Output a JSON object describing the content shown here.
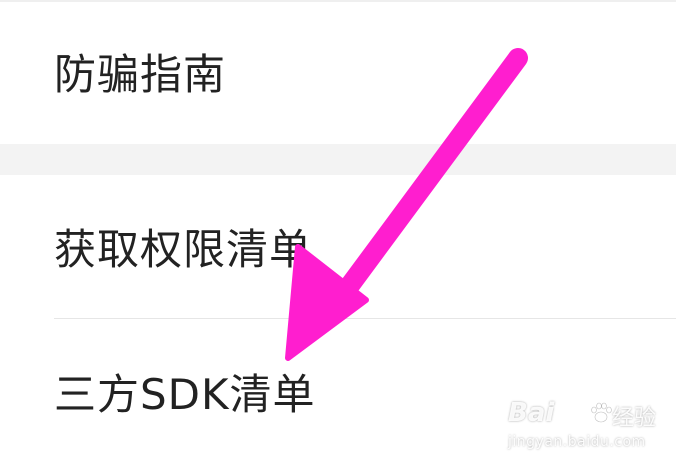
{
  "menu": {
    "items": [
      {
        "label": "防骗指南"
      },
      {
        "label": "获取权限清单"
      },
      {
        "label": "三方SDK清单"
      }
    ]
  },
  "annotation": {
    "arrow_color": "#ff1ecf"
  },
  "watermark": {
    "logo_text": "Bai",
    "name": "经验",
    "url": "jingyan.baidu.com"
  }
}
